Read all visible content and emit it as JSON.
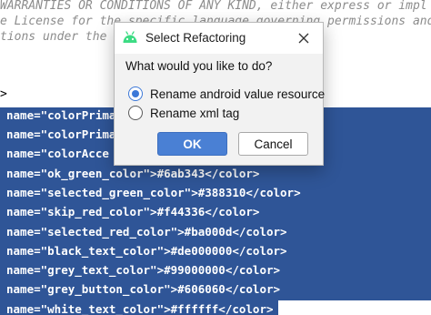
{
  "editor": {
    "comment_lines": [
      "WARRANTIES OR CONDITIONS OF ANY KIND, either express or impl",
      "e License for the specific language governing permissions and",
      "tions under the L"
    ],
    "caret_line": ">",
    "code_lines": [
      "name=\"colorPrima",
      "name=\"colorPrima",
      "name=\"colorAcce",
      "name=\"ok_green_color\">#6ab343</color>",
      "name=\"selected_green_color\">#388310</color>",
      "name=\"skip_red_color\">#f44336</color>",
      "name=\"selected_red_color\">#ba000d</color>",
      "name=\"black_text_color\">#de000000</color>",
      "name=\"grey_text_color\">#99000000</color>",
      "name=\"grey_button_color\">#606060</color>",
      "name=\"white_text_color\">#ffffff</color>"
    ],
    "colors": {
      "selection": "#2f5597",
      "comment": "#8c8c8c"
    }
  },
  "dialog": {
    "title": "Select Refactoring",
    "icon": "android-icon",
    "close_icon": "close-icon",
    "question": "What would you like to do?",
    "options": [
      {
        "label": "Rename android value resource",
        "selected": true
      },
      {
        "label": "Rename xml tag",
        "selected": false
      }
    ],
    "ok_label": "OK",
    "cancel_label": "Cancel",
    "colors": {
      "accent": "#4a80d4",
      "android_green": "#3ddc84"
    }
  }
}
